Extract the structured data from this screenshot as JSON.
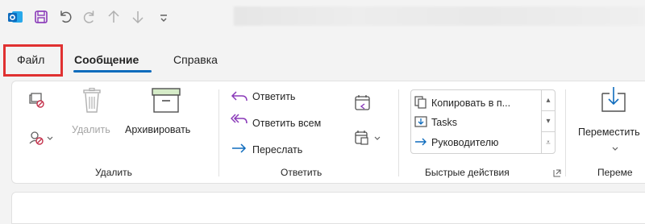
{
  "tabs": {
    "file": "Файл",
    "message": "Сообщение",
    "help": "Справка"
  },
  "ribbon": {
    "delete_group": {
      "delete_label": "Удалить",
      "archive_label": "Архивировать",
      "group_label": "Удалить"
    },
    "respond_group": {
      "reply_label": "Ответить",
      "reply_all_label": "Ответить всем",
      "forward_label": "Переслать",
      "group_label": "Ответить"
    },
    "quick_steps_group": {
      "items": [
        "Копировать в п...",
        "Tasks",
        "Руководителю"
      ],
      "group_label": "Быстрые действия"
    },
    "move_group": {
      "move_label": "Переместить",
      "group_label": "Переме"
    }
  },
  "colors": {
    "accent": "#0f6cbd",
    "highlight_box": "#e03131",
    "outlook_blue": "#0f6cbd",
    "save_purple": "#8a3ab9"
  },
  "icons": [
    "outlook-icon",
    "save-icon",
    "undo-icon",
    "redo-icon",
    "up-arrow-icon",
    "down-arrow-icon",
    "customize-qat-icon"
  ]
}
